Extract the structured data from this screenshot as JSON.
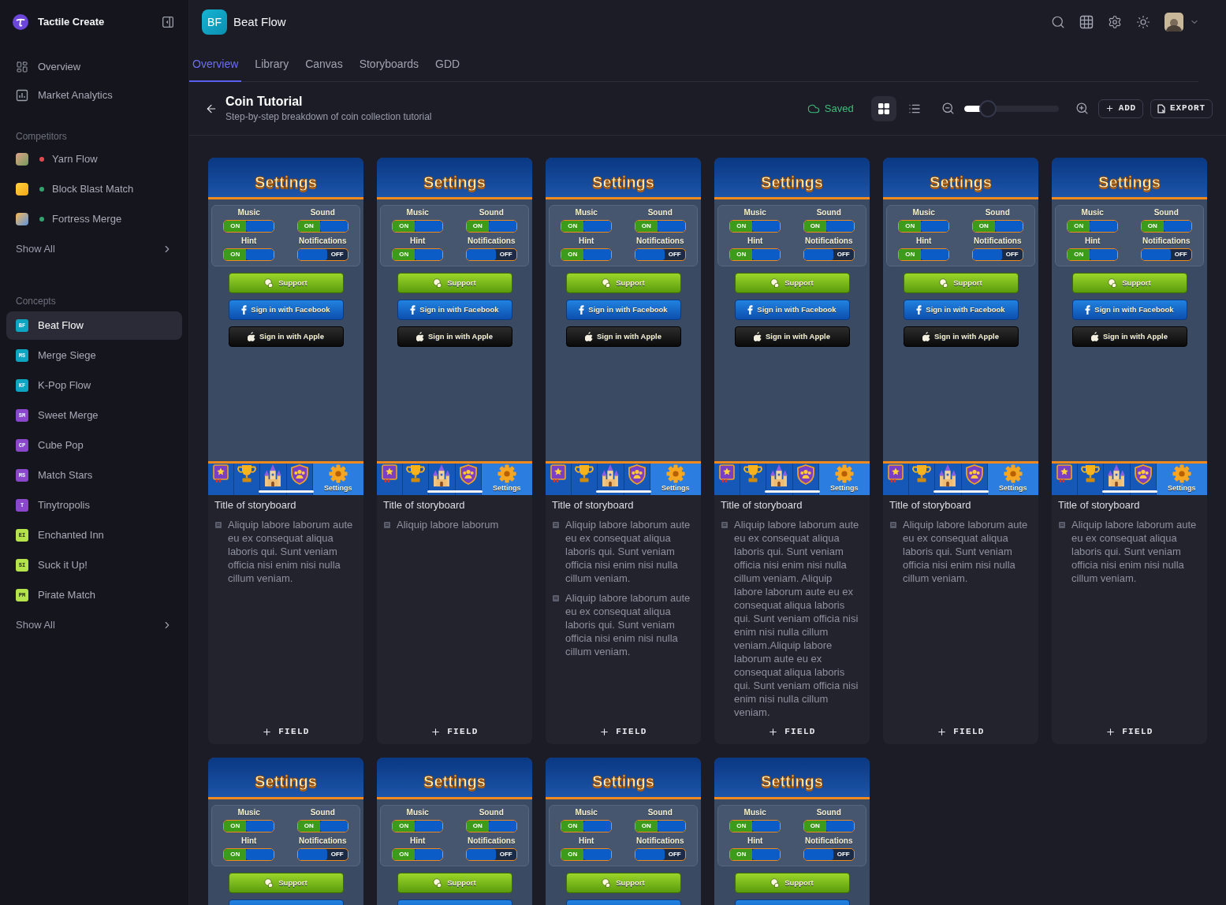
{
  "sidebar": {
    "brand": "Tactile Create",
    "nav": [
      {
        "kind": "overview",
        "label": "Overview"
      },
      {
        "kind": "analytics",
        "label": "Market Analytics"
      }
    ],
    "competitors": {
      "heading": "Competitors",
      "items": [
        {
          "name": "Yarn Flow",
          "color": "#e5484d"
        },
        {
          "name": "Block Blast Match",
          "color": "#30a46c"
        },
        {
          "name": "Fortress Merge",
          "color": "#30a46c"
        }
      ],
      "show_all": "Show All"
    },
    "concepts": {
      "heading": "Concepts",
      "items": [
        {
          "initials": "BF",
          "name": "Beat Flow",
          "color": "#0ea5c2",
          "selected": true
        },
        {
          "initials": "MS",
          "name": "Merge Siege",
          "color": "#0ea5c2",
          "selected": false
        },
        {
          "initials": "KF",
          "name": "K-Pop Flow",
          "color": "#0ea5c2",
          "selected": false
        },
        {
          "initials": "SM",
          "name": "Sweet Merge",
          "color": "#8b47cc",
          "selected": false
        },
        {
          "initials": "CP",
          "name": "Cube Pop",
          "color": "#8b47cc",
          "selected": false
        },
        {
          "initials": "MS",
          "name": "Match Stars",
          "color": "#8b47cc",
          "selected": false
        },
        {
          "initials": "T",
          "name": "Tinytropolis",
          "color": "#8b47cc",
          "selected": false
        },
        {
          "initials": "EI",
          "name": "Enchanted Inn",
          "color": "#b4e34c",
          "selected": false
        },
        {
          "initials": "SI",
          "name": "Suck it Up!",
          "color": "#b4e34c",
          "selected": false
        },
        {
          "initials": "PM",
          "name": "Pirate Match",
          "color": "#b4e34c",
          "selected": false
        }
      ],
      "show_all": "Show All"
    }
  },
  "header": {
    "project": {
      "initials": "BF",
      "name": "Beat Flow"
    }
  },
  "tabs": [
    {
      "label": "Overview",
      "selected": true
    },
    {
      "label": "Library",
      "selected": false
    },
    {
      "label": "Canvas",
      "selected": false
    },
    {
      "label": "Storyboards",
      "selected": false
    },
    {
      "label": "GDD",
      "selected": false
    }
  ],
  "page": {
    "title": "Coin Tutorial",
    "subtitle": "Step-by-step breakdown of coin collection tutorial",
    "status": "Saved",
    "view_modes": [
      {
        "kind": "grid",
        "selected": true
      },
      {
        "kind": "list",
        "selected": false
      }
    ],
    "zoom": {
      "level": 0.2
    },
    "actions": [
      {
        "kind": "add",
        "label": "ADD"
      },
      {
        "kind": "export",
        "label": "EXPORT"
      }
    ]
  },
  "cards": [
    {
      "screen": {
        "title": "Settings",
        "toggles": [
          {
            "label": "Music",
            "on": true,
            "state": "ON"
          },
          {
            "label": "Sound",
            "on": true,
            "state": "ON"
          },
          {
            "label": "Hint",
            "on": true,
            "state": "ON"
          },
          {
            "label": "Notifications",
            "on": false,
            "state": "OFF"
          }
        ],
        "buttons": [
          {
            "kind": "support",
            "label": "Support"
          },
          {
            "kind": "facebook",
            "label": "Sign in with Facebook"
          },
          {
            "kind": "apple",
            "label": "Sign in with Apple"
          }
        ],
        "nav": [
          {
            "kind": "book",
            "selected": false
          },
          {
            "kind": "trophy",
            "selected": false
          },
          {
            "kind": "castle",
            "selected": false
          },
          {
            "kind": "shield",
            "selected": false
          },
          {
            "kind": "gear",
            "label": "Settings",
            "selected": true
          }
        ]
      },
      "title": "Title of storyboard",
      "notes": [
        "Aliquip labore laborum aute eu ex consequat aliqua laboris qui. Sunt veniam officia nisi enim nisi nulla cillum veniam."
      ],
      "add_label": "FIELD"
    },
    {
      "screen": {
        "title": "Settings",
        "toggles": [
          {
            "label": "Music",
            "on": true,
            "state": "ON"
          },
          {
            "label": "Sound",
            "on": true,
            "state": "ON"
          },
          {
            "label": "Hint",
            "on": true,
            "state": "ON"
          },
          {
            "label": "Notifications",
            "on": false,
            "state": "OFF"
          }
        ],
        "buttons": [
          {
            "kind": "support",
            "label": "Support"
          },
          {
            "kind": "facebook",
            "label": "Sign in with Facebook"
          },
          {
            "kind": "apple",
            "label": "Sign in with Apple"
          }
        ],
        "nav": [
          {
            "kind": "book",
            "selected": false
          },
          {
            "kind": "trophy",
            "selected": false
          },
          {
            "kind": "castle",
            "selected": false
          },
          {
            "kind": "shield",
            "selected": false
          },
          {
            "kind": "gear",
            "label": "Settings",
            "selected": true
          }
        ]
      },
      "title": "Title of storyboard",
      "notes": [
        "Aliquip labore laborum"
      ],
      "add_label": "FIELD"
    },
    {
      "screen": {
        "title": "Settings",
        "toggles": [
          {
            "label": "Music",
            "on": true,
            "state": "ON"
          },
          {
            "label": "Sound",
            "on": true,
            "state": "ON"
          },
          {
            "label": "Hint",
            "on": true,
            "state": "ON"
          },
          {
            "label": "Notifications",
            "on": false,
            "state": "OFF"
          }
        ],
        "buttons": [
          {
            "kind": "support",
            "label": "Support"
          },
          {
            "kind": "facebook",
            "label": "Sign in with Facebook"
          },
          {
            "kind": "apple",
            "label": "Sign in with Apple"
          }
        ],
        "nav": [
          {
            "kind": "book",
            "selected": false
          },
          {
            "kind": "trophy",
            "selected": false
          },
          {
            "kind": "castle",
            "selected": false
          },
          {
            "kind": "shield",
            "selected": false
          },
          {
            "kind": "gear",
            "label": "Settings",
            "selected": true
          }
        ]
      },
      "title": "Title of storyboard",
      "notes": [
        "Aliquip labore laborum aute eu ex consequat aliqua laboris qui. Sunt veniam officia nisi enim nisi nulla cillum veniam.",
        "Aliquip labore laborum aute eu ex consequat aliqua laboris qui. Sunt veniam officia nisi enim nisi nulla cillum veniam."
      ],
      "add_label": "FIELD"
    },
    {
      "screen": {
        "title": "Settings",
        "toggles": [
          {
            "label": "Music",
            "on": true,
            "state": "ON"
          },
          {
            "label": "Sound",
            "on": true,
            "state": "ON"
          },
          {
            "label": "Hint",
            "on": true,
            "state": "ON"
          },
          {
            "label": "Notifications",
            "on": false,
            "state": "OFF"
          }
        ],
        "buttons": [
          {
            "kind": "support",
            "label": "Support"
          },
          {
            "kind": "facebook",
            "label": "Sign in with Facebook"
          },
          {
            "kind": "apple",
            "label": "Sign in with Apple"
          }
        ],
        "nav": [
          {
            "kind": "book",
            "selected": false
          },
          {
            "kind": "trophy",
            "selected": false
          },
          {
            "kind": "castle",
            "selected": false
          },
          {
            "kind": "shield",
            "selected": false
          },
          {
            "kind": "gear",
            "label": "Settings",
            "selected": true
          }
        ]
      },
      "title": "Title of storyboard",
      "notes": [
        "Aliquip labore laborum aute eu ex consequat aliqua laboris qui. Sunt veniam officia nisi enim nisi nulla cillum veniam. Aliquip labore laborum aute eu ex consequat aliqua laboris qui. Sunt veniam officia nisi enim nisi nulla cillum veniam.Aliquip labore laborum aute eu ex consequat aliqua laboris qui. Sunt veniam officia nisi enim nisi nulla cillum veniam."
      ],
      "add_label": "FIELD"
    },
    {
      "screen": {
        "title": "Settings",
        "toggles": [
          {
            "label": "Music",
            "on": true,
            "state": "ON"
          },
          {
            "label": "Sound",
            "on": true,
            "state": "ON"
          },
          {
            "label": "Hint",
            "on": true,
            "state": "ON"
          },
          {
            "label": "Notifications",
            "on": false,
            "state": "OFF"
          }
        ],
        "buttons": [
          {
            "kind": "support",
            "label": "Support"
          },
          {
            "kind": "facebook",
            "label": "Sign in with Facebook"
          },
          {
            "kind": "apple",
            "label": "Sign in with Apple"
          }
        ],
        "nav": [
          {
            "kind": "book",
            "selected": false
          },
          {
            "kind": "trophy",
            "selected": false
          },
          {
            "kind": "castle",
            "selected": false
          },
          {
            "kind": "shield",
            "selected": false
          },
          {
            "kind": "gear",
            "label": "Settings",
            "selected": true
          }
        ]
      },
      "title": "Title of storyboard",
      "notes": [
        "Aliquip labore laborum aute eu ex consequat aliqua laboris qui. Sunt veniam officia nisi enim nisi nulla cillum veniam."
      ],
      "add_label": "FIELD"
    },
    {
      "screen": {
        "title": "Settings",
        "toggles": [
          {
            "label": "Music",
            "on": true,
            "state": "ON"
          },
          {
            "label": "Sound",
            "on": true,
            "state": "ON"
          },
          {
            "label": "Hint",
            "on": true,
            "state": "ON"
          },
          {
            "label": "Notifications",
            "on": false,
            "state": "OFF"
          }
        ],
        "buttons": [
          {
            "kind": "support",
            "label": "Support"
          },
          {
            "kind": "facebook",
            "label": "Sign in with Facebook"
          },
          {
            "kind": "apple",
            "label": "Sign in with Apple"
          }
        ],
        "nav": [
          {
            "kind": "book",
            "selected": false
          },
          {
            "kind": "trophy",
            "selected": false
          },
          {
            "kind": "castle",
            "selected": false
          },
          {
            "kind": "shield",
            "selected": false
          },
          {
            "kind": "gear",
            "label": "Settings",
            "selected": true
          }
        ]
      },
      "title": "Title of storyboard",
      "notes": [
        "Aliquip labore laborum aute eu ex consequat aliqua laboris qui. Sunt veniam officia nisi enim nisi nulla cillum veniam."
      ],
      "add_label": "FIELD"
    },
    {
      "screen": {
        "title": "Settings",
        "toggles": [
          {
            "label": "Music",
            "on": true,
            "state": "ON"
          },
          {
            "label": "Sound",
            "on": true,
            "state": "ON"
          },
          {
            "label": "Hint",
            "on": true,
            "state": "ON"
          },
          {
            "label": "Notifications",
            "on": false,
            "state": "OFF"
          }
        ],
        "buttons": [
          {
            "kind": "support",
            "label": "Support"
          },
          {
            "kind": "facebook"
          }
        ]
      }
    },
    {
      "screen": {
        "title": "Settings",
        "toggles": [
          {
            "label": "Music",
            "on": true,
            "state": "ON"
          },
          {
            "label": "Sound",
            "on": true,
            "state": "ON"
          },
          {
            "label": "Hint",
            "on": true,
            "state": "ON"
          },
          {
            "label": "Notifications",
            "on": false,
            "state": "OFF"
          }
        ],
        "buttons": [
          {
            "kind": "support",
            "label": "Support"
          },
          {
            "kind": "facebook"
          }
        ]
      }
    },
    {
      "screen": {
        "title": "Settings",
        "toggles": [
          {
            "label": "Music",
            "on": true,
            "state": "ON"
          },
          {
            "label": "Sound",
            "on": true,
            "state": "ON"
          },
          {
            "label": "Hint",
            "on": true,
            "state": "ON"
          },
          {
            "label": "Notifications",
            "on": false,
            "state": "OFF"
          }
        ],
        "buttons": [
          {
            "kind": "support",
            "label": "Support"
          },
          {
            "kind": "facebook"
          }
        ]
      }
    },
    {
      "screen": {
        "title": "Settings",
        "toggles": [
          {
            "label": "Music",
            "on": true,
            "state": "ON"
          },
          {
            "label": "Sound",
            "on": true,
            "state": "ON"
          },
          {
            "label": "Hint",
            "on": true,
            "state": "ON"
          },
          {
            "label": "Notifications",
            "on": false,
            "state": "OFF"
          }
        ],
        "buttons": [
          {
            "kind": "support",
            "label": "Support"
          },
          {
            "kind": "facebook"
          }
        ]
      }
    }
  ]
}
